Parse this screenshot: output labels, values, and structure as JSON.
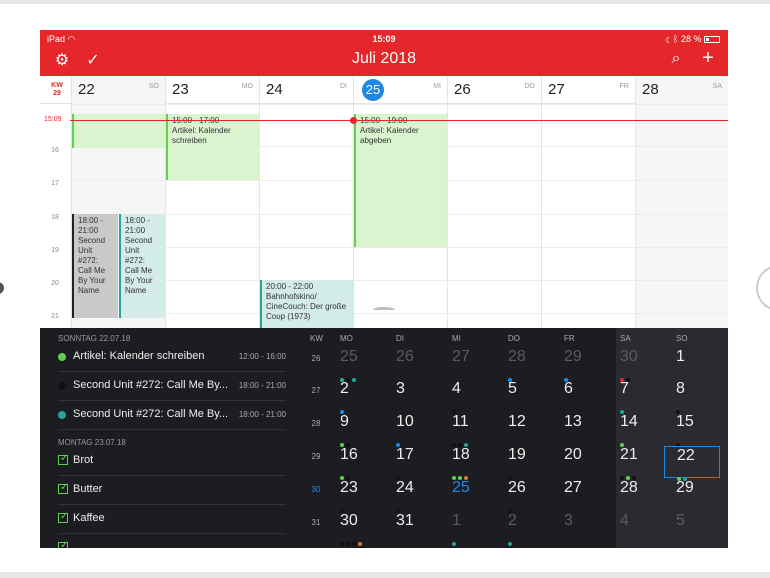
{
  "status": {
    "carrier": "iPad",
    "wifi_icon": "wifi-icon",
    "time": "15:09",
    "battery": "28 %"
  },
  "nav": {
    "title": "Juli 2018"
  },
  "week": {
    "kw_label": "KW",
    "kw_number": "29",
    "days": [
      {
        "num": "22",
        "abbr": "SO"
      },
      {
        "num": "23",
        "abbr": "MO"
      },
      {
        "num": "24",
        "abbr": "DI"
      },
      {
        "num": "25",
        "abbr": "MI"
      },
      {
        "num": "26",
        "abbr": "DO"
      },
      {
        "num": "27",
        "abbr": "FR"
      },
      {
        "num": "28",
        "abbr": "SA"
      }
    ]
  },
  "grid": {
    "now_time": "15:09",
    "hours": [
      "16",
      "17",
      "18",
      "19",
      "20",
      "21"
    ],
    "events": [
      {
        "time": "15:00 - 17:00",
        "title": "Artikel: Kalender schreiben"
      },
      {
        "time": "15:00 - 19:00",
        "title": "Artikel: Kalender abgeben"
      },
      {
        "time": "18:00 - 21:00",
        "title": "Second Unit #272: Call Me By Your Name"
      },
      {
        "time": "18:00 - 21:00",
        "title": "Second Unit #272: Call Me By Your Name"
      },
      {
        "time": "20:00 - 22:00",
        "title": "Bahnhofskino/ CineCouch: Der große Coup (1973)"
      }
    ]
  },
  "list": {
    "sections": [
      {
        "header": "SONNTAG 22.07.18",
        "items": [
          {
            "title": "Artikel: Kalender schreiben",
            "time": "12:00 - 16:00",
            "color": "#5fd14b"
          },
          {
            "title": "Second Unit #272: Call Me By...",
            "time": "18:00 - 21:00",
            "color": "#111111"
          },
          {
            "title": "Second Unit #272: Call Me By...",
            "time": "18:00 - 21:00",
            "color": "#2ba29a"
          }
        ]
      },
      {
        "header": "MONTAG 23.07.18",
        "items": [
          {
            "title": "Brot"
          },
          {
            "title": "Butter"
          },
          {
            "title": "Kaffee"
          }
        ]
      }
    ]
  },
  "month": {
    "headers": [
      "KW",
      "MO",
      "DI",
      "MI",
      "DO",
      "FR",
      "SA",
      "SO"
    ],
    "weeks": [
      {
        "kw": "26",
        "days": [
          "25",
          "26",
          "27",
          "28",
          "29",
          "30",
          "1"
        ]
      },
      {
        "kw": "27",
        "days": [
          "2",
          "3",
          "4",
          "5",
          "6",
          "7",
          "8"
        ]
      },
      {
        "kw": "28",
        "days": [
          "9",
          "10",
          "11",
          "12",
          "13",
          "14",
          "15"
        ]
      },
      {
        "kw": "29",
        "days": [
          "16",
          "17",
          "18",
          "19",
          "20",
          "21",
          "22"
        ]
      },
      {
        "kw": "30",
        "days": [
          "23",
          "24",
          "25",
          "26",
          "27",
          "28",
          "29"
        ]
      },
      {
        "kw": "31",
        "days": [
          "30",
          "31",
          "1",
          "2",
          "3",
          "4",
          "5"
        ]
      }
    ]
  },
  "colors": {
    "accent_red": "#e5262a",
    "today_blue": "#1e88e5",
    "green": "#5fd14b",
    "teal": "#2ba29a"
  }
}
